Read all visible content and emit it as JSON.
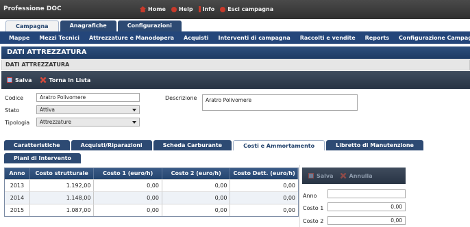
{
  "app": {
    "title": "Professione DOC"
  },
  "top_nav": [
    {
      "label": "Home",
      "icon": "home-icon"
    },
    {
      "label": "Help",
      "icon": "help-icon"
    },
    {
      "label": "Info",
      "icon": "info-icon"
    },
    {
      "label": "Esci campagna",
      "icon": "exit-icon"
    }
  ],
  "main_tabs": [
    {
      "label": "Campagna",
      "active": true
    },
    {
      "label": "Anagrafiche",
      "active": false
    },
    {
      "label": "Configurazioni",
      "active": false
    }
  ],
  "submenu": [
    "Mappe",
    "Mezzi Tecnici",
    "Attrezzature e Manodopera",
    "Acquisti",
    "Interventi di campagna",
    "Raccolti e vendite",
    "Reports",
    "Configurazione Campagna"
  ],
  "page": {
    "title": "DATI ATTREZZATURA",
    "section": "DATI ATTREZZATURA"
  },
  "toolbar": {
    "save_label": "Salva",
    "back_label": "Torna in Lista"
  },
  "form": {
    "codice_label": "Codice",
    "codice_value": "Aratro Polivomere",
    "stato_label": "Stato",
    "stato_value": "Attiva",
    "tipologia_label": "Tipologia",
    "tipologia_value": "Attrezzature",
    "descrizione_label": "Descrizione",
    "descrizione_value": "Aratro Polivomere"
  },
  "detail_tabs": [
    {
      "label": "Caratteristiche",
      "active": false
    },
    {
      "label": "Acquisti/Riparazioni",
      "active": false
    },
    {
      "label": "Scheda Carburante",
      "active": false
    },
    {
      "label": "Costi e Ammortamento",
      "active": true
    },
    {
      "label": "Libretto di Manutenzione",
      "active": false
    }
  ],
  "detail_tabs_row2": [
    {
      "label": "Piani di Intervento"
    }
  ],
  "grid": {
    "columns": [
      "Anno",
      "Costo strutturale",
      "Costo 1 (euro/h)",
      "Costo 2 (euro/h)",
      "Costo Dett. (euro/h)"
    ],
    "rows": [
      [
        "2013",
        "1.192,00",
        "0,00",
        "0,00",
        "0,00"
      ],
      [
        "2014",
        "1.148,00",
        "0,00",
        "0,00",
        "0,00"
      ],
      [
        "2015",
        "1.087,00",
        "0,00",
        "0,00",
        "0,00"
      ]
    ]
  },
  "edit_panel": {
    "save_label": "Salva",
    "cancel_label": "Annulla",
    "anno_label": "Anno",
    "anno_value": "",
    "costo1_label": "Costo 1",
    "costo1_value": "0,00",
    "costo2_label": "Costo 2",
    "costo2_value": "0,00"
  }
}
